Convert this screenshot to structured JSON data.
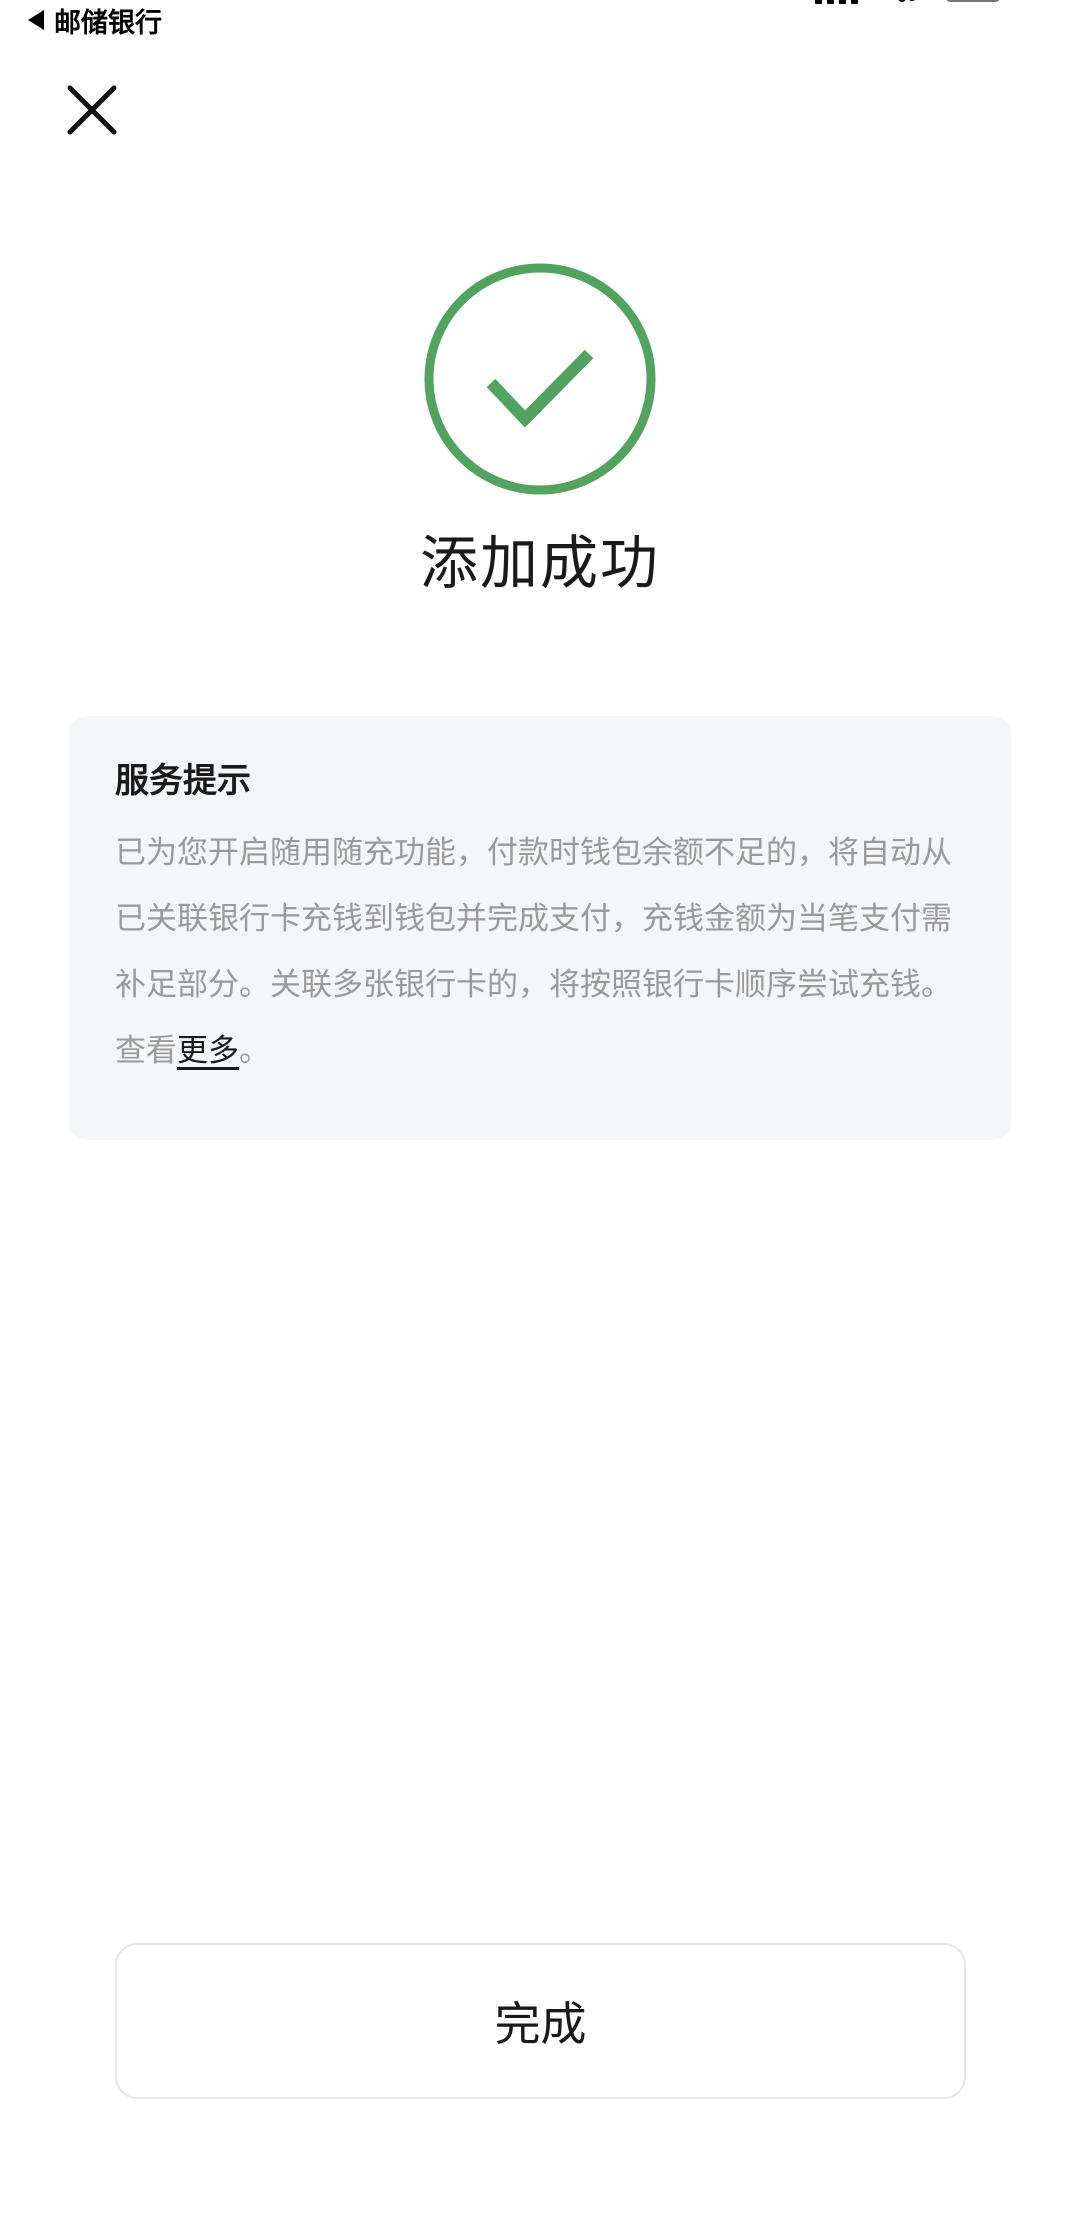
{
  "status_bar": {
    "back_app_label": "邮储银行"
  },
  "header": {
    "close_icon": "close-icon"
  },
  "success": {
    "icon": "check-circle-icon",
    "accent_color": "#52a35f",
    "title": "添加成功"
  },
  "service_tip": {
    "title": "服务提示",
    "body": "已为您开启随用随充功能，付款时钱包余额不足的，将自动从已关联银行卡充钱到钱包并完成支付，充钱金额为当笔支付需补足部分。关联多张银行卡的，将按照银行卡顺序尝试充钱。查看",
    "more_link": "更多",
    "end_punct": "。"
  },
  "footer": {
    "done_label": "完成"
  }
}
